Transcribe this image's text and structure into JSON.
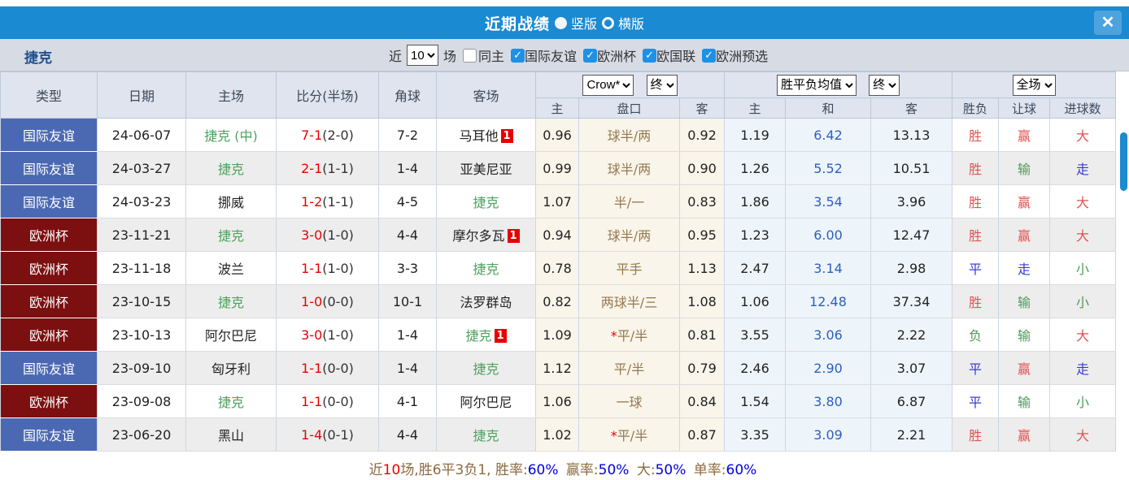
{
  "header": {
    "title": "近期战绩",
    "vertical_label": "竖版",
    "horizontal_label": "横版",
    "close_label": "✕"
  },
  "filter": {
    "team": "捷克",
    "recent_label": "近",
    "recent_value": "10",
    "games_label": "场",
    "same_home_label": "同主",
    "checkmark": "✓",
    "competitions": [
      {
        "label": "国际友谊",
        "checked": true
      },
      {
        "label": "欧洲杯",
        "checked": true
      },
      {
        "label": "欧国联",
        "checked": true
      },
      {
        "label": "欧洲预选",
        "checked": true
      }
    ]
  },
  "table": {
    "columns": [
      "类型",
      "日期",
      "主场",
      "比分(半场)",
      "角球",
      "客场"
    ],
    "odds_group": {
      "bookmaker": "Crow*",
      "stage": "终",
      "sub_home": "主",
      "sub_line": "盘口",
      "sub_away": "客"
    },
    "avg_group": {
      "name": "胜平负均值",
      "stage": "终",
      "sub_home": "主",
      "sub_draw": "和",
      "sub_away": "客"
    },
    "result_group": {
      "name": "全场",
      "sub_wdl": "胜负",
      "sub_handicap": "让球",
      "sub_goals": "进球数"
    },
    "rows": [
      {
        "type": "国际友谊",
        "date": "24-06-07",
        "home": "捷克 (中)",
        "home_green": true,
        "score": "7-1",
        "half": "(2-0)",
        "corner": "7-2",
        "away": "马耳他",
        "away_green": false,
        "away_badge": "1",
        "odds_home": "0.96",
        "handicap_star": "",
        "handicap": "球半/两",
        "odds_away": "0.92",
        "avg_win": "1.19",
        "avg_draw": "6.42",
        "avg_lose": "13.13",
        "wdl": "胜",
        "handicap_result": "赢",
        "goals": "大"
      },
      {
        "type": "国际友谊",
        "date": "24-03-27",
        "home": "捷克",
        "home_green": true,
        "score": "2-1",
        "half": "(1-1)",
        "corner": "1-4",
        "away": "亚美尼亚",
        "away_green": false,
        "away_badge": "",
        "odds_home": "0.99",
        "handicap_star": "",
        "handicap": "球半/两",
        "odds_away": "0.90",
        "avg_win": "1.26",
        "avg_draw": "5.52",
        "avg_lose": "10.51",
        "wdl": "胜",
        "handicap_result": "输",
        "goals": "走"
      },
      {
        "type": "国际友谊",
        "date": "24-03-23",
        "home": "挪威",
        "home_green": false,
        "score": "1-2",
        "half": "(1-1)",
        "corner": "4-5",
        "away": "捷克",
        "away_green": true,
        "away_badge": "",
        "odds_home": "1.07",
        "handicap_star": "",
        "handicap": "半/一",
        "odds_away": "0.83",
        "avg_win": "1.86",
        "avg_draw": "3.54",
        "avg_lose": "3.96",
        "wdl": "胜",
        "handicap_result": "赢",
        "goals": "大"
      },
      {
        "type": "欧洲杯",
        "date": "23-11-21",
        "home": "捷克",
        "home_green": true,
        "score": "3-0",
        "half": "(1-0)",
        "corner": "4-4",
        "away": "摩尔多瓦",
        "away_green": false,
        "away_badge": "1",
        "odds_home": "0.94",
        "handicap_star": "",
        "handicap": "球半/两",
        "odds_away": "0.95",
        "avg_win": "1.23",
        "avg_draw": "6.00",
        "avg_lose": "12.47",
        "wdl": "胜",
        "handicap_result": "赢",
        "goals": "大"
      },
      {
        "type": "欧洲杯",
        "date": "23-11-18",
        "home": "波兰",
        "home_green": false,
        "score": "1-1",
        "half": "(1-0)",
        "corner": "3-3",
        "away": "捷克",
        "away_green": true,
        "away_badge": "",
        "odds_home": "0.78",
        "handicap_star": "",
        "handicap": "平手",
        "odds_away": "1.13",
        "avg_win": "2.47",
        "avg_draw": "3.14",
        "avg_lose": "2.98",
        "wdl": "平",
        "handicap_result": "走",
        "goals": "小"
      },
      {
        "type": "欧洲杯",
        "date": "23-10-15",
        "home": "捷克",
        "home_green": true,
        "score": "1-0",
        "half": "(0-0)",
        "corner": "10-1",
        "away": "法罗群岛",
        "away_green": false,
        "away_badge": "",
        "odds_home": "0.82",
        "handicap_star": "",
        "handicap": "两球半/三",
        "odds_away": "1.08",
        "avg_win": "1.06",
        "avg_draw": "12.48",
        "avg_lose": "37.34",
        "wdl": "胜",
        "handicap_result": "输",
        "goals": "小"
      },
      {
        "type": "欧洲杯",
        "date": "23-10-13",
        "home": "阿尔巴尼",
        "home_green": false,
        "score": "3-0",
        "half": "(1-0)",
        "corner": "1-4",
        "away": "捷克",
        "away_green": true,
        "away_badge": "1",
        "odds_home": "1.09",
        "handicap_star": "*",
        "handicap": "平/半",
        "odds_away": "0.81",
        "avg_win": "3.55",
        "avg_draw": "3.06",
        "avg_lose": "2.22",
        "wdl": "负",
        "handicap_result": "输",
        "goals": "大"
      },
      {
        "type": "国际友谊",
        "date": "23-09-10",
        "home": "匈牙利",
        "home_green": false,
        "score": "1-1",
        "half": "(0-0)",
        "corner": "1-4",
        "away": "捷克",
        "away_green": true,
        "away_badge": "",
        "odds_home": "1.12",
        "handicap_star": "",
        "handicap": "平/半",
        "odds_away": "0.79",
        "avg_win": "2.46",
        "avg_draw": "2.90",
        "avg_lose": "3.07",
        "wdl": "平",
        "handicap_result": "赢",
        "goals": "走"
      },
      {
        "type": "欧洲杯",
        "date": "23-09-08",
        "home": "捷克",
        "home_green": true,
        "score": "1-1",
        "half": "(0-0)",
        "corner": "4-1",
        "away": "阿尔巴尼",
        "away_green": false,
        "away_badge": "",
        "odds_home": "1.06",
        "handicap_star": "",
        "handicap": "一球",
        "odds_away": "0.84",
        "avg_win": "1.54",
        "avg_draw": "3.80",
        "avg_lose": "6.87",
        "wdl": "平",
        "handicap_result": "输",
        "goals": "小"
      },
      {
        "type": "国际友谊",
        "date": "23-06-20",
        "home": "黑山",
        "home_green": false,
        "score": "1-4",
        "half": "(0-1)",
        "corner": "4-4",
        "away": "捷克",
        "away_green": true,
        "away_badge": "",
        "odds_home": "1.02",
        "handicap_star": "*",
        "handicap": "平/半",
        "odds_away": "0.87",
        "avg_win": "3.35",
        "avg_draw": "3.09",
        "avg_lose": "2.21",
        "wdl": "胜",
        "handicap_result": "赢",
        "goals": "大"
      }
    ]
  },
  "summary": {
    "prefix": "近",
    "count": "10",
    "middle": "场,胜6平3负1, 胜率:",
    "win_rate": "60%",
    "handicap_label": "赢率:",
    "handicap_rate": "50%",
    "big_label": "大:",
    "big_rate": "50%",
    "single_label": "单率:",
    "single_rate": "60%"
  },
  "colors": {
    "type": {
      "国际友谊": "#4b69b3",
      "欧洲杯": "#7c0f10"
    },
    "result": {
      "胜": "#e05252",
      "平": "#3b3bd0",
      "负": "#4e9a58",
      "赢": "#e05252",
      "输": "#4e9a58",
      "走": "#3b3bd0",
      "大": "#e05252",
      "小": "#4e9a58"
    }
  }
}
